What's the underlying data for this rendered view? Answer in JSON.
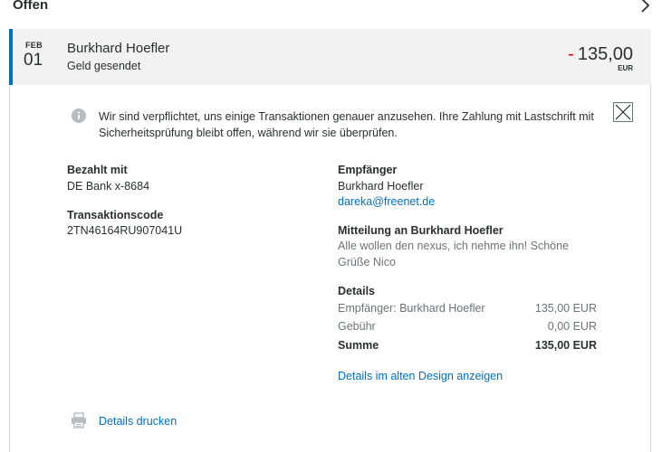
{
  "section": {
    "title": "Offen"
  },
  "transaction": {
    "month": "FEB",
    "day": "01",
    "name": "Burkhard Hoefler",
    "status": "Geld gesendet",
    "amount_sign": "-",
    "amount": "135,00",
    "currency": "EUR"
  },
  "notice": {
    "text": "Wir sind verpflichtet, uns einige Transaktionen genauer anzusehen. Ihre Zahlung mit Lastschrift mit Sicherheitsprüfung bleibt offen, während wir sie überprüfen."
  },
  "paid_with": {
    "label": "Bezahlt mit",
    "value": "DE Bank x-8684"
  },
  "transaction_code": {
    "label": "Transaktionscode",
    "value": "2TN46164RU907041U"
  },
  "recipient": {
    "label": "Empfänger",
    "name": "Burkhard Hoefler",
    "email": "dareka@freenet.de"
  },
  "message": {
    "label": "Mitteilung an Burkhard Hoefler",
    "line1": "Alle wollen den nexus, ich nehme ihn! Schöne",
    "line2": "Grüße Nico"
  },
  "details": {
    "label": "Details",
    "rows": [
      {
        "label": "Empfänger: Burkhard Hoefler",
        "value": "135,00 EUR"
      },
      {
        "label": "Gebühr",
        "value": "0,00 EUR"
      }
    ],
    "total_label": "Summe",
    "total_value": "135,00 EUR"
  },
  "links": {
    "old_design": "Details im alten Design anzeigen",
    "print": "Details drucken"
  },
  "colors": {
    "accent": "#0070ba",
    "negative": "#d20000",
    "row_bg": "#f2f2f2",
    "muted": "#6c7378"
  },
  "icons": {
    "chevron": "chevron-right-icon",
    "info": "info-icon",
    "close": "close-icon",
    "print": "printer-icon"
  }
}
